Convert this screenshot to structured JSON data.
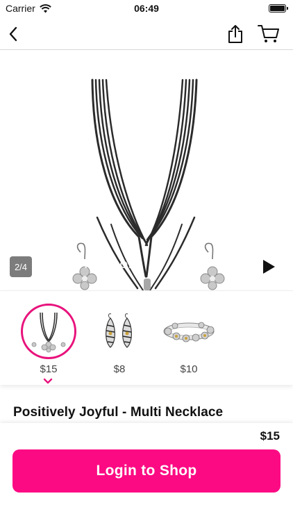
{
  "status_bar": {
    "carrier": "Carrier",
    "time": "06:49"
  },
  "nav": {
    "back_icon": "chevron-left-icon",
    "share_icon": "share-icon",
    "cart_icon": "cart-icon"
  },
  "gallery": {
    "counter": "2/4",
    "watermark": "SHOP THE LOOK",
    "play_icon": "play-icon"
  },
  "look_items": [
    {
      "name": "necklace",
      "price": "$15",
      "selected": true
    },
    {
      "name": "earrings",
      "price": "$8",
      "selected": false
    },
    {
      "name": "bracelet",
      "price": "$10",
      "selected": false
    }
  ],
  "product": {
    "title": "Positively Joyful - Multi Necklace",
    "price": "$15"
  },
  "actions": {
    "login_label": "Login to Shop"
  },
  "colors": {
    "accent": "#fc0a83",
    "selection_ring": "#e8127c",
    "counter_bg": "#7c7c7c"
  }
}
